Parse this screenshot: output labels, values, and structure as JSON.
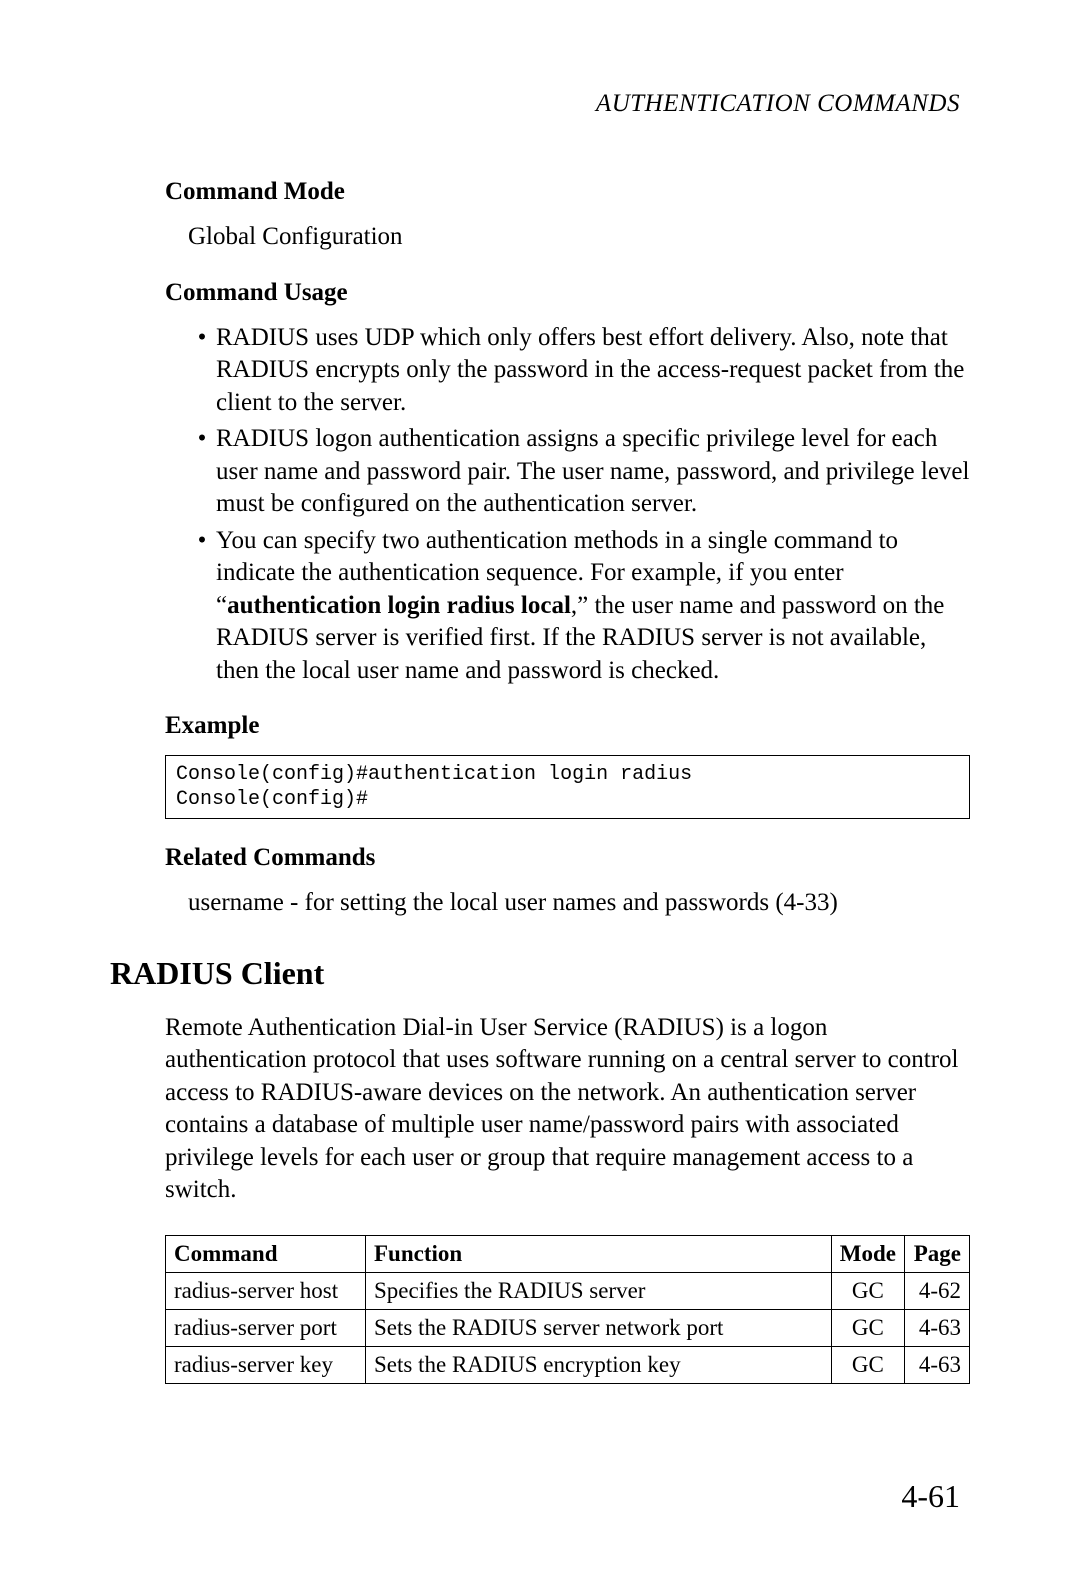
{
  "header": {
    "title": "AUTHENTICATION COMMANDS"
  },
  "sections": {
    "command_mode": {
      "heading": "Command Mode",
      "text": "Global Configuration"
    },
    "command_usage": {
      "heading": "Command Usage",
      "bullets": [
        "RADIUS uses UDP which only offers best effort delivery. Also, note that RADIUS encrypts only the password in the access-request packet from the client to the server.",
        "RADIUS logon authentication assigns a specific privilege level for each user name and password pair. The user name, password, and privilege level must be configured on the authentication server.",
        {
          "pre": "You can specify two authentication methods in a single command to indicate the authentication sequence. For example, if you enter “",
          "bold": "authentication login radius local",
          "post": ",” the user name and password on the RADIUS server is verified first. If the RADIUS server is not available, then the local user name and password is checked."
        }
      ]
    },
    "example": {
      "heading": "Example",
      "code": "Console(config)#authentication login radius\nConsole(config)#"
    },
    "related_commands": {
      "heading": "Related Commands",
      "text": "username - for setting the local user names and passwords (4-33)"
    },
    "radius_client": {
      "heading": "RADIUS Client",
      "paragraph": "Remote Authentication Dial-in User Service (RADIUS) is a logon authentication protocol that uses software running on a central server to control access to RADIUS-aware devices on the network. An authentication server contains a database of multiple user name/password pairs with associated privilege levels for each user or group that require management access to a switch."
    }
  },
  "table": {
    "headers": {
      "command": "Command",
      "function": "Function",
      "mode": "Mode",
      "page": "Page"
    },
    "rows": [
      {
        "command": "radius-server host",
        "function": "Specifies the RADIUS server",
        "mode": "GC",
        "page": "4-62"
      },
      {
        "command": "radius-server port",
        "function": "Sets the RADIUS server network port",
        "mode": "GC",
        "page": "4-63"
      },
      {
        "command": "radius-server key",
        "function": "Sets the RADIUS encryption key",
        "mode": "GC",
        "page": "4-63"
      }
    ]
  },
  "page_number": "4-61"
}
